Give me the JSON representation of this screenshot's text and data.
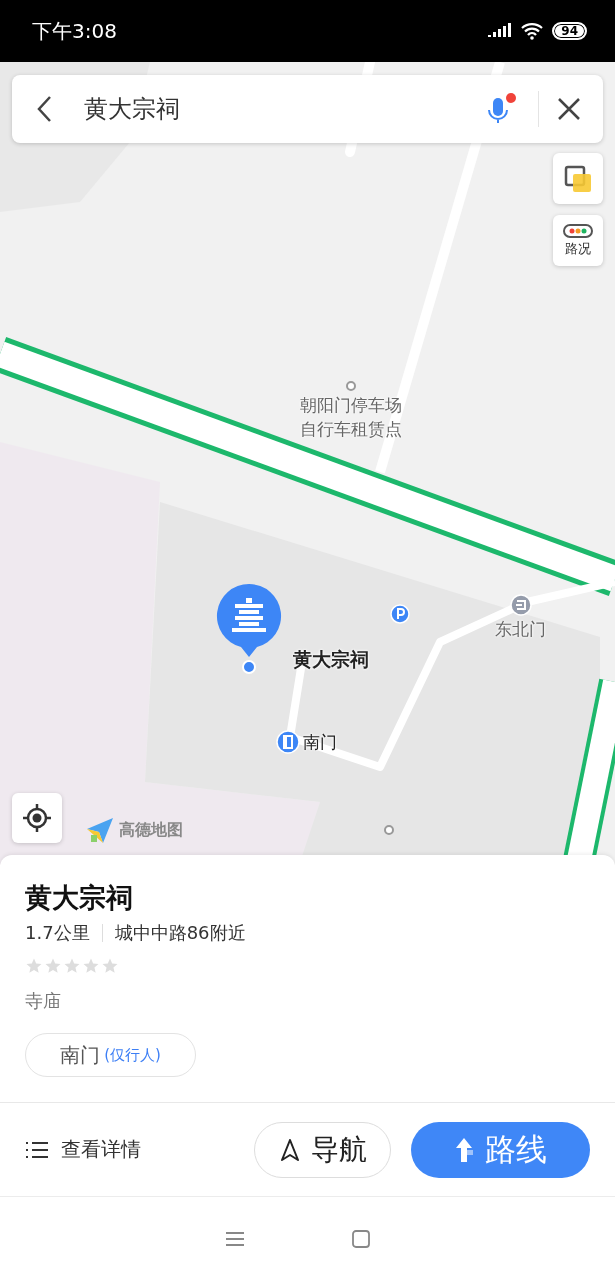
{
  "status_bar": {
    "time": "下午3:08",
    "battery": "94"
  },
  "search": {
    "value": "黄大宗祠"
  },
  "map_controls": [
    {
      "kind": "layers"
    },
    {
      "kind": "traffic",
      "label": "路况"
    }
  ],
  "map": {
    "labels": [
      {
        "kind": "dot",
        "lines": [
          "朝阳门停车场",
          "自行车租赁点"
        ]
      },
      {
        "kind": "marker",
        "label": "黄大宗祠"
      },
      {
        "kind": "parking"
      },
      {
        "kind": "exit",
        "label": "东北门"
      },
      {
        "kind": "door",
        "label": "南门"
      },
      {
        "kind": "dot"
      }
    ],
    "logo": "高德地图"
  },
  "place": {
    "name": "黄大宗祠",
    "distance": "1.7公里",
    "address": "城中中路86附近",
    "stars": 0,
    "category": "寺庙",
    "entrance": {
      "name": "南门",
      "note": "(仅行人)"
    }
  },
  "actions": [
    {
      "kind": "details",
      "label": "查看详情"
    },
    {
      "kind": "navigate",
      "label": "导航"
    },
    {
      "kind": "route",
      "label": "路线"
    }
  ]
}
